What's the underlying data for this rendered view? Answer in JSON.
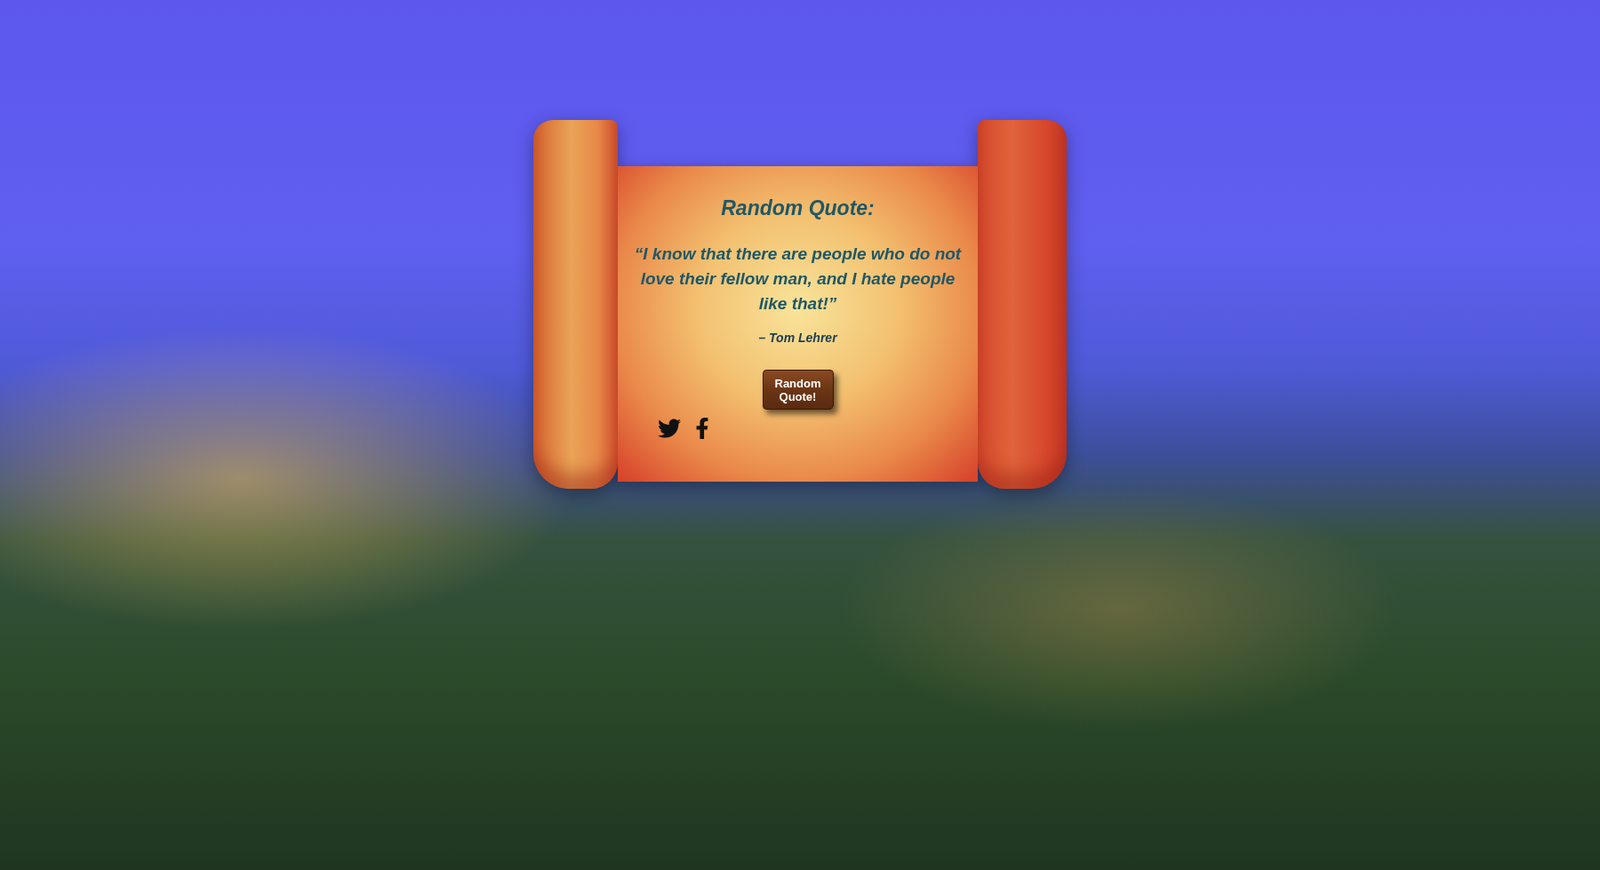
{
  "card": {
    "title": "Random Quote:"
  },
  "quote": {
    "text": "“I know that there are people who do not love their fellow man, and I hate people like that!”",
    "author": "– Tom Lehrer"
  },
  "button": {
    "label": "Random Quote!"
  }
}
